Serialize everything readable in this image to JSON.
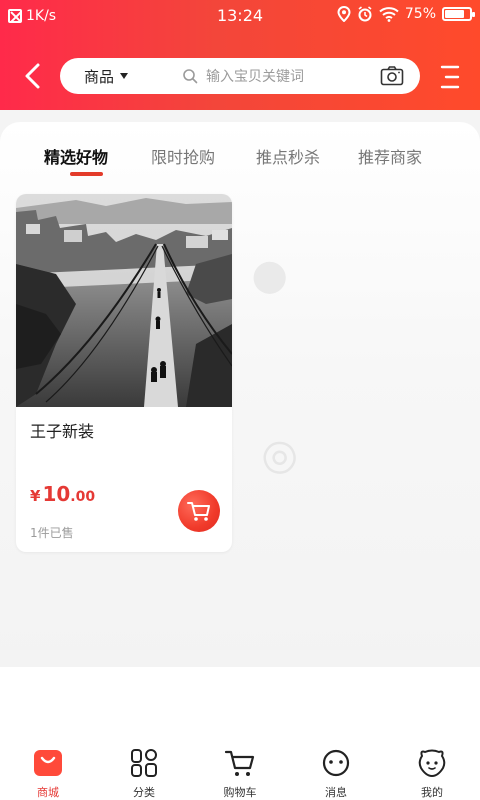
{
  "status_bar": {
    "speed": "1K/s",
    "time": "13:24",
    "battery": "75%"
  },
  "top_bar": {
    "category": "商品",
    "search_placeholder": "输入宝贝关键词"
  },
  "tabs": [
    {
      "label": "精选好物",
      "active": true
    },
    {
      "label": "限时抢购",
      "active": false
    },
    {
      "label": "推点秒杀",
      "active": false
    },
    {
      "label": "推荐商家",
      "active": false
    }
  ],
  "product": {
    "title": "王子新装",
    "price_symbol": "¥",
    "price_int": "10",
    "price_dec": ".00",
    "sold": "1件已售"
  },
  "bottom_nav": [
    {
      "label": "商城",
      "icon": "bag-icon",
      "active": true
    },
    {
      "label": "分类",
      "icon": "grid-icon",
      "active": false
    },
    {
      "label": "购物车",
      "icon": "cart-icon",
      "active": false
    },
    {
      "label": "消息",
      "icon": "message-face-icon",
      "active": false
    },
    {
      "label": "我的",
      "icon": "user-face-icon",
      "active": false
    }
  ],
  "colors": {
    "brand_red": "#f3463a",
    "price_red": "#e53935",
    "tab_indicator": "#e33b2a"
  }
}
